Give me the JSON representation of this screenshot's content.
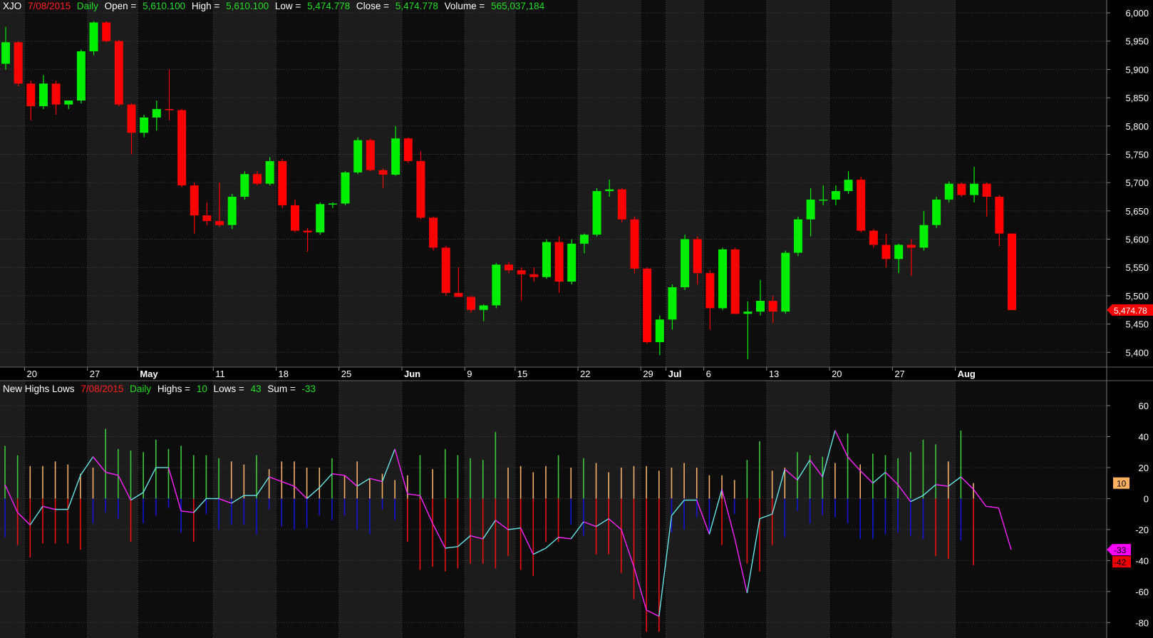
{
  "price_header": {
    "symbol": "XJO",
    "date": "7/08/2015",
    "period": "Daily",
    "open_label": "Open =",
    "open": "5,610.100",
    "high_label": "High =",
    "high": "5,610.100",
    "low_label": "Low =",
    "low": "5,474.778",
    "close_label": "Close =",
    "close": "5,474.778",
    "volume_label": "Volume =",
    "volume": "565,037,184"
  },
  "indicator_header": {
    "name": "New Highs Lows",
    "date": "7/08/2015",
    "period": "Daily",
    "highs_label": "Highs =",
    "highs": "10",
    "lows_label": "Lows =",
    "lows": "43",
    "sum_label": "Sum =",
    "sum": "-33"
  },
  "colors": {
    "background": "#000000",
    "panel_dark": "#0d0d0d",
    "panel_light": "#1c1c1c",
    "up": "#00ee00",
    "down": "#ff0000",
    "grid": "#404040",
    "axis_text": "#ffffff",
    "highs_above_avg": "#f5b06a",
    "highs_green": "#3ec83e",
    "lows_red": "#ee1111",
    "lows_blue": "#1414d2",
    "sum_up_line": "#66e6e6",
    "sum_down_line": "#ff22ff",
    "badge_orange": "#ffb060",
    "badge_magenta": "#ff00ff",
    "badge_red": "#ee0000"
  },
  "chart_data": [
    {
      "type": "candlestick",
      "symbol": "XJO",
      "ylim": [
        5355,
        6000
      ],
      "yticks": [
        5400,
        5450,
        5500,
        5550,
        5600,
        5650,
        5700,
        5750,
        5800,
        5850,
        5900,
        5950,
        6000
      ],
      "ytick_labels": [
        "5,400",
        "5,450",
        "5,500",
        "5,550",
        "5,600",
        "5,650",
        "5,700",
        "5,750",
        "5,800",
        "5,850",
        "5,900",
        "5,950",
        "6,000"
      ],
      "x_labels": [
        {
          "i": 2,
          "label": "20",
          "bold": false
        },
        {
          "i": 7,
          "label": "27",
          "bold": false
        },
        {
          "i": 11,
          "label": "May",
          "bold": true
        },
        {
          "i": 17,
          "label": "11",
          "bold": false
        },
        {
          "i": 22,
          "label": "18",
          "bold": false
        },
        {
          "i": 27,
          "label": "25",
          "bold": false
        },
        {
          "i": 32,
          "label": "Jun",
          "bold": true
        },
        {
          "i": 37,
          "label": "9",
          "bold": false
        },
        {
          "i": 41,
          "label": "15",
          "bold": false
        },
        {
          "i": 46,
          "label": "22",
          "bold": false
        },
        {
          "i": 51,
          "label": "29",
          "bold": false
        },
        {
          "i": 53,
          "label": "Jul",
          "bold": true
        },
        {
          "i": 56,
          "label": "6",
          "bold": false
        },
        {
          "i": 61,
          "label": "13",
          "bold": false
        },
        {
          "i": 66,
          "label": "20",
          "bold": false
        },
        {
          "i": 71,
          "label": "27",
          "bold": false
        },
        {
          "i": 76,
          "label": "Aug",
          "bold": true
        }
      ],
      "last_price_label": "5,474.78",
      "candles": [
        [
          5910,
          5975,
          5900,
          5948
        ],
        [
          5948,
          5950,
          5870,
          5875
        ],
        [
          5875,
          5880,
          5810,
          5835
        ],
        [
          5835,
          5890,
          5830,
          5875
        ],
        [
          5875,
          5880,
          5820,
          5838
        ],
        [
          5838,
          5845,
          5830,
          5845
        ],
        [
          5845,
          5935,
          5840,
          5932
        ],
        [
          5932,
          5985,
          5925,
          5983
        ],
        [
          5983,
          5985,
          5948,
          5950
        ],
        [
          5950,
          5952,
          5835,
          5838
        ],
        [
          5838,
          5840,
          5750,
          5788
        ],
        [
          5788,
          5820,
          5780,
          5815
        ],
        [
          5815,
          5845,
          5792,
          5830
        ],
        [
          5830,
          5900,
          5810,
          5828
        ],
        [
          5828,
          5830,
          5692,
          5695
        ],
        [
          5695,
          5700,
          5610,
          5642
        ],
        [
          5642,
          5665,
          5625,
          5632
        ],
        [
          5632,
          5700,
          5622,
          5625
        ],
        [
          5625,
          5680,
          5618,
          5675
        ],
        [
          5675,
          5720,
          5670,
          5715
        ],
        [
          5715,
          5720,
          5695,
          5698
        ],
        [
          5698,
          5745,
          5695,
          5738
        ],
        [
          5738,
          5742,
          5655,
          5660
        ],
        [
          5660,
          5670,
          5612,
          5615
        ],
        [
          5615,
          5620,
          5578,
          5612
        ],
        [
          5612,
          5665,
          5608,
          5662
        ],
        [
          5662,
          5665,
          5655,
          5663
        ],
        [
          5663,
          5720,
          5660,
          5718
        ],
        [
          5718,
          5780,
          5715,
          5775
        ],
        [
          5775,
          5778,
          5720,
          5722
        ],
        [
          5722,
          5725,
          5690,
          5714
        ],
        [
          5714,
          5800,
          5712,
          5778
        ],
        [
          5778,
          5780,
          5735,
          5738
        ],
        [
          5738,
          5755,
          5635,
          5638
        ],
        [
          5638,
          5640,
          5580,
          5585
        ],
        [
          5585,
          5588,
          5500,
          5505
        ],
        [
          5505,
          5550,
          5498,
          5498
        ],
        [
          5498,
          5500,
          5470,
          5475
        ],
        [
          5475,
          5485,
          5455,
          5483
        ],
        [
          5483,
          5558,
          5478,
          5555
        ],
        [
          5555,
          5560,
          5540,
          5545
        ],
        [
          5545,
          5550,
          5492,
          5538
        ],
        [
          5538,
          5550,
          5525,
          5533
        ],
        [
          5533,
          5600,
          5530,
          5595
        ],
        [
          5595,
          5605,
          5505,
          5525
        ],
        [
          5525,
          5600,
          5520,
          5592
        ],
        [
          5592,
          5610,
          5575,
          5608
        ],
        [
          5608,
          5690,
          5605,
          5685
        ],
        [
          5685,
          5705,
          5675,
          5688
        ],
        [
          5688,
          5690,
          5630,
          5635
        ],
        [
          5635,
          5640,
          5540,
          5548
        ],
        [
          5548,
          5550,
          5415,
          5418
        ],
        [
          5418,
          5465,
          5395,
          5458
        ],
        [
          5458,
          5520,
          5440,
          5515
        ],
        [
          5515,
          5608,
          5510,
          5600
        ],
        [
          5600,
          5605,
          5520,
          5540
        ],
        [
          5540,
          5545,
          5440,
          5478
        ],
        [
          5478,
          5585,
          5475,
          5582
        ],
        [
          5582,
          5585,
          5470,
          5468
        ],
        [
          5468,
          5490,
          5388,
          5472
        ],
        [
          5472,
          5528,
          5465,
          5491
        ],
        [
          5491,
          5500,
          5452,
          5472
        ],
        [
          5472,
          5580,
          5468,
          5576
        ],
        [
          5576,
          5640,
          5570,
          5635
        ],
        [
          5635,
          5690,
          5605,
          5670
        ],
        [
          5670,
          5695,
          5660,
          5670
        ],
        [
          5670,
          5695,
          5660,
          5685
        ],
        [
          5685,
          5720,
          5680,
          5705
        ],
        [
          5705,
          5710,
          5612,
          5615
        ],
        [
          5615,
          5618,
          5585,
          5590
        ],
        [
          5590,
          5610,
          5550,
          5565
        ],
        [
          5565,
          5592,
          5540,
          5590
        ],
        [
          5590,
          5600,
          5535,
          5585
        ],
        [
          5585,
          5650,
          5580,
          5625
        ],
        [
          5625,
          5675,
          5620,
          5670
        ],
        [
          5670,
          5702,
          5665,
          5698
        ],
        [
          5698,
          5700,
          5675,
          5678
        ],
        [
          5678,
          5728,
          5665,
          5698
        ],
        [
          5698,
          5700,
          5640,
          5675
        ],
        [
          5675,
          5678,
          5588,
          5610
        ],
        [
          5610,
          5610,
          5474.778,
          5474.778
        ]
      ]
    },
    {
      "type": "bar+line",
      "name": "New Highs Lows",
      "ylim": [
        -90,
        66
      ],
      "yticks": [
        -80,
        -60,
        -40,
        -20,
        0,
        20,
        40,
        60
      ],
      "ytick_labels": [
        "-80",
        "-60",
        "-40",
        "-20",
        "0",
        "20",
        "40",
        "60"
      ],
      "highs": [
        34,
        28,
        21,
        21,
        24,
        22,
        16,
        20,
        45,
        32,
        31,
        30,
        38,
        32,
        34,
        28,
        28,
        26,
        24,
        22,
        28,
        19,
        24,
        24,
        20,
        20,
        26,
        15,
        24,
        13,
        16,
        12,
        15,
        28,
        19,
        32,
        28,
        26,
        25,
        43,
        20,
        21,
        17,
        21,
        28,
        20,
        26,
        23,
        17,
        20,
        21,
        21,
        18,
        20,
        23,
        20,
        15,
        15,
        12,
        25,
        37,
        18,
        20,
        30,
        28,
        27,
        23,
        42,
        22,
        29,
        28,
        26,
        30,
        38,
        35,
        24,
        44,
        10
      ],
      "lows": [
        25,
        30,
        38,
        29,
        29,
        29,
        33,
        16,
        9,
        13,
        28,
        16,
        11,
        6,
        22,
        28,
        10,
        20,
        17,
        17,
        23,
        7,
        18,
        20,
        19,
        11,
        14,
        11,
        20,
        23,
        7,
        14,
        28,
        46,
        44,
        47,
        45,
        42,
        42,
        45,
        37,
        46,
        50,
        28,
        28,
        17,
        24,
        36,
        36,
        48,
        65,
        86,
        86,
        22,
        20,
        12,
        23,
        30,
        10,
        42,
        47,
        30,
        25,
        8,
        16,
        11,
        12,
        16,
        26,
        26,
        23,
        22,
        24,
        26,
        37,
        39,
        27,
        43
      ],
      "sum": [
        9,
        -9,
        -17,
        -5,
        -7,
        -7,
        15,
        27,
        17,
        15,
        -1,
        4,
        20,
        20,
        -8,
        -9,
        0,
        0,
        -3,
        2,
        2,
        14,
        11,
        8,
        0,
        7,
        16,
        15,
        8,
        13,
        11,
        32,
        3,
        2,
        -16,
        -32,
        -31,
        -24,
        -26,
        -14,
        -20,
        -19,
        -36,
        -32,
        -25,
        -26,
        -15,
        -18,
        -13,
        -20,
        -44,
        -72,
        -76,
        -11,
        -1,
        -1,
        -23,
        6,
        -25,
        -61,
        -13,
        -10,
        19,
        12,
        25,
        14,
        44,
        27,
        18,
        10,
        17,
        9,
        -2,
        2,
        9,
        8,
        14,
        6,
        -5,
        -6,
        -33
      ],
      "badges": {
        "highs": "10",
        "sum": "-33",
        "lows": "-42"
      }
    }
  ]
}
